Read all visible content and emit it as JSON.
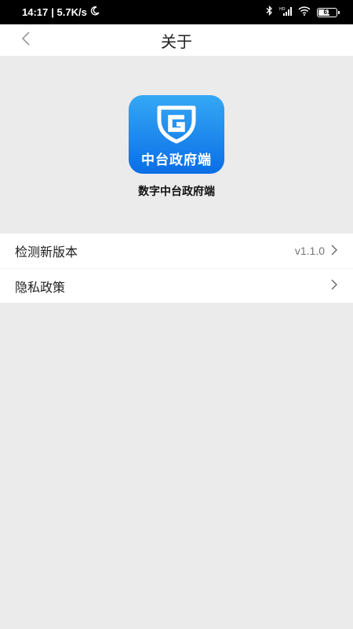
{
  "status_bar": {
    "time": "14:17",
    "speed": "| 5.7K/s",
    "battery": "61",
    "icons": [
      "moon-icon",
      "bluetooth-icon",
      "signal-icon",
      "wifi-icon",
      "battery-icon"
    ]
  },
  "header": {
    "title": "关于",
    "back_icon": "chevron-left-icon"
  },
  "app": {
    "icon_text": "中台政府端",
    "logo_letter": "G",
    "name": "数字中台政府端"
  },
  "menu": {
    "items": [
      {
        "label": "检测新版本",
        "value": "v1.1.0",
        "icon": "chevron-right-icon"
      },
      {
        "label": "隐私政策",
        "value": "",
        "icon": "chevron-right-icon"
      }
    ]
  },
  "colors": {
    "background": "#ebebeb",
    "icon_gradient_top": "#35a8f5",
    "icon_gradient_bottom": "#0a6ee6",
    "status_bar": "#000000"
  }
}
